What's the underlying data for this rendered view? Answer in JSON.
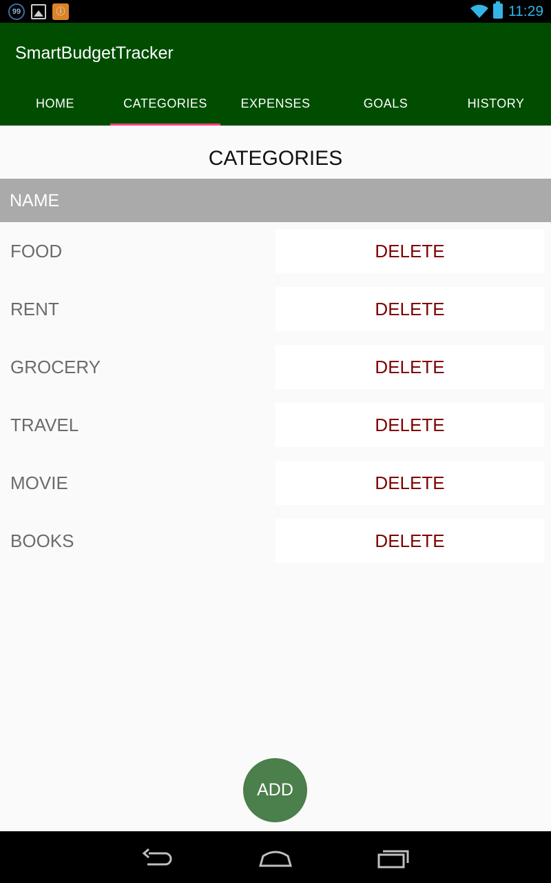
{
  "status_bar": {
    "notification_badge": "99",
    "time": "11:29",
    "icons": [
      "counter-icon",
      "image-icon",
      "notification-icon",
      "wifi-icon",
      "battery-icon"
    ]
  },
  "app_bar": {
    "title": "SmartBudgetTracker",
    "tabs": [
      {
        "label": "HOME"
      },
      {
        "label": "CATEGORIES"
      },
      {
        "label": "EXPENSES"
      },
      {
        "label": "GOALS"
      },
      {
        "label": "HISTORY"
      }
    ],
    "active_tab": "CATEGORIES"
  },
  "main": {
    "page_title": "CATEGORIES",
    "table_header": "NAME",
    "rows": [
      {
        "name": "FOOD",
        "action": "DELETE"
      },
      {
        "name": "RENT",
        "action": "DELETE"
      },
      {
        "name": "GROCERY",
        "action": "DELETE"
      },
      {
        "name": "TRAVEL",
        "action": "DELETE"
      },
      {
        "name": "MOVIE",
        "action": "DELETE"
      },
      {
        "name": "BOOKS",
        "action": "DELETE"
      }
    ],
    "add_button": "ADD"
  },
  "nav_bar": {
    "icons": [
      "back-icon",
      "home-icon",
      "recents-icon"
    ]
  },
  "colors": {
    "app_bar": "#004d00",
    "tab_indicator": "#ff4081",
    "header_row": "#aaaaaa",
    "delete_text": "#7f0000",
    "fab": "#4b7f4b",
    "status_accent": "#33b5e5"
  }
}
